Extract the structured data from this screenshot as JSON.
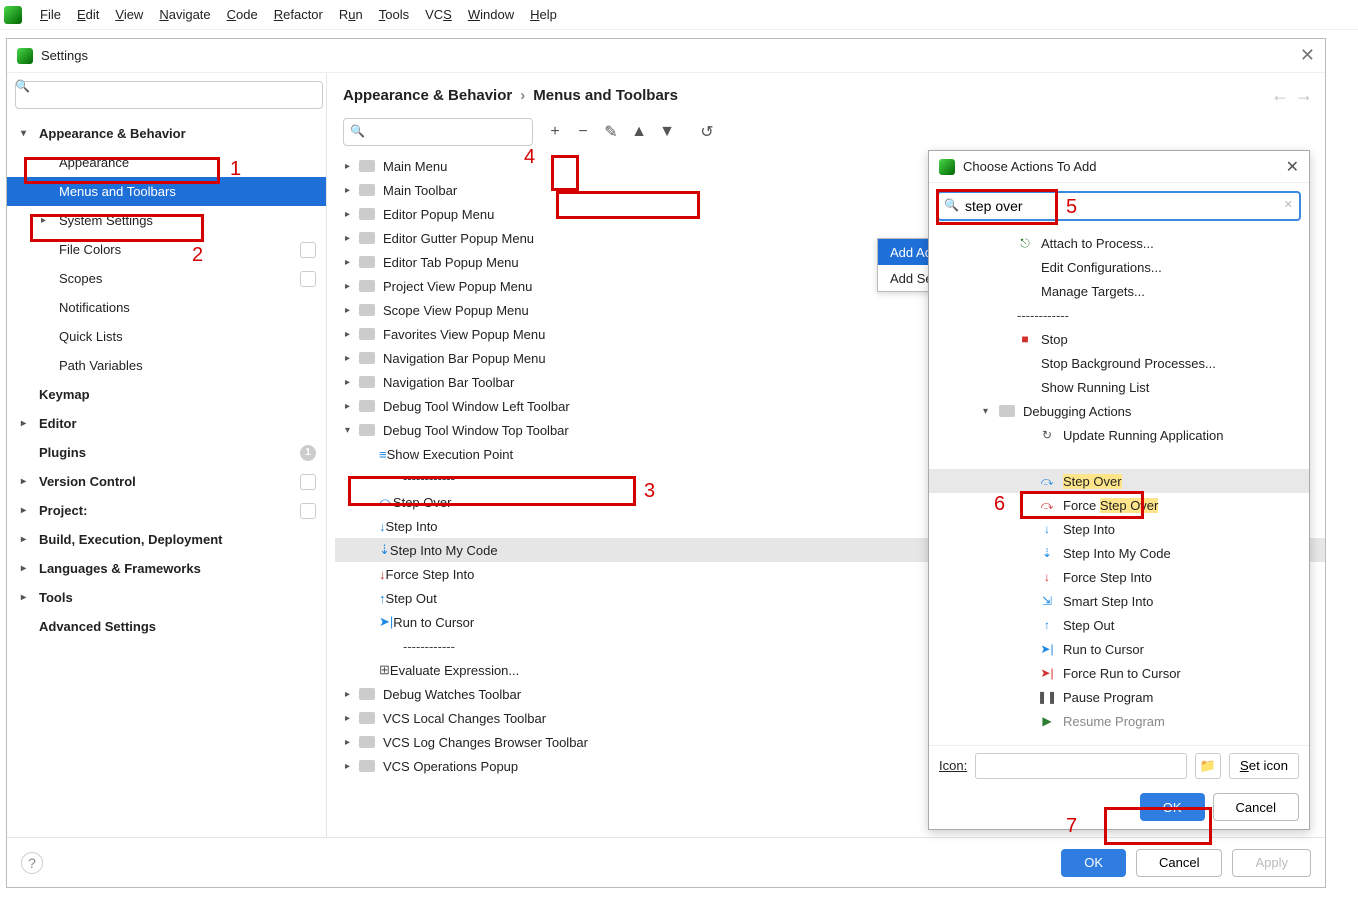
{
  "menubar": [
    "File",
    "Edit",
    "View",
    "Navigate",
    "Code",
    "Refactor",
    "Run",
    "Tools",
    "VCS",
    "Window",
    "Help"
  ],
  "settings": {
    "title": "Settings",
    "breadcrumb": [
      "Appearance & Behavior",
      "Menus and Toolbars"
    ],
    "sidebar": [
      {
        "label": "Appearance & Behavior",
        "level": 1,
        "bold": true,
        "arrow": "▾"
      },
      {
        "label": "Appearance",
        "level": 2
      },
      {
        "label": "Menus and Toolbars",
        "level": 2,
        "selected": true
      },
      {
        "label": "System Settings",
        "level": 2,
        "arrow": "▸"
      },
      {
        "label": "File Colors",
        "level": 2,
        "badge": "▭"
      },
      {
        "label": "Scopes",
        "level": 2,
        "badge": "▭"
      },
      {
        "label": "Notifications",
        "level": 2
      },
      {
        "label": "Quick Lists",
        "level": 2
      },
      {
        "label": "Path Variables",
        "level": 2
      },
      {
        "label": "Keymap",
        "level": 1,
        "bold": true
      },
      {
        "label": "Editor",
        "level": 1,
        "bold": true,
        "arrow": "▸"
      },
      {
        "label": "Plugins",
        "level": 1,
        "bold": true,
        "badge": "1"
      },
      {
        "label": "Version Control",
        "level": 1,
        "bold": true,
        "arrow": "▸",
        "badge": "▭"
      },
      {
        "label": "Project:",
        "level": 1,
        "bold": true,
        "arrow": "▸",
        "badge": "▭"
      },
      {
        "label": "Build, Execution, Deployment",
        "level": 1,
        "bold": true,
        "arrow": "▸"
      },
      {
        "label": "Languages & Frameworks",
        "level": 1,
        "bold": true,
        "arrow": "▸"
      },
      {
        "label": "Tools",
        "level": 1,
        "bold": true,
        "arrow": "▸"
      },
      {
        "label": "Advanced Settings",
        "level": 1,
        "bold": true
      }
    ],
    "toolbar_buttons": [
      "+",
      "−",
      "✎",
      "▲",
      "▼",
      "↺"
    ],
    "popup_menu": [
      "Add Action...",
      "Add Separator"
    ],
    "list": [
      {
        "label": "Main Menu",
        "type": "folder",
        "arrow": "▸"
      },
      {
        "label": "Main Toolbar",
        "type": "folder",
        "arrow": "▸"
      },
      {
        "label": "Editor Popup Menu",
        "type": "folder",
        "arrow": "▸"
      },
      {
        "label": "Editor Gutter Popup Menu",
        "type": "folder",
        "arrow": "▸"
      },
      {
        "label": "Editor Tab Popup Menu",
        "type": "folder",
        "arrow": "▸"
      },
      {
        "label": "Project View Popup Menu",
        "type": "folder",
        "arrow": "▸"
      },
      {
        "label": "Scope View Popup Menu",
        "type": "folder",
        "arrow": "▸"
      },
      {
        "label": "Favorites View Popup Menu",
        "type": "folder",
        "arrow": "▸"
      },
      {
        "label": "Navigation Bar Popup Menu",
        "type": "folder",
        "arrow": "▸"
      },
      {
        "label": "Navigation Bar Toolbar",
        "type": "folder",
        "arrow": "▸"
      },
      {
        "label": "Debug Tool Window Left Toolbar",
        "type": "folder",
        "arrow": "▸"
      },
      {
        "label": "Debug Tool Window Top Toolbar",
        "type": "folder",
        "arrow": "▾",
        "expanded": true
      },
      {
        "label": "Show Execution Point",
        "type": "action",
        "indent": 1,
        "icon": "exec",
        "color": "#1e88e5"
      },
      {
        "label": "------------",
        "type": "sep",
        "indent": 1
      },
      {
        "label": "Step Over",
        "type": "action",
        "indent": 1,
        "icon": "stepover",
        "color": "#1e88e5"
      },
      {
        "label": "Step Into",
        "type": "action",
        "indent": 1,
        "icon": "stepinto",
        "color": "#1e88e5"
      },
      {
        "label": "Step Into My Code",
        "type": "action",
        "indent": 1,
        "icon": "stepmycode",
        "color": "#1e88e5",
        "selected": true
      },
      {
        "label": "Force Step Into",
        "type": "action",
        "indent": 1,
        "icon": "forcestep",
        "color": "#d32f2f"
      },
      {
        "label": "Step Out",
        "type": "action",
        "indent": 1,
        "icon": "stepout",
        "color": "#1e88e5"
      },
      {
        "label": "Run to Cursor",
        "type": "action",
        "indent": 1,
        "icon": "runcursor",
        "color": "#1e88e5"
      },
      {
        "label": "------------",
        "type": "sep",
        "indent": 1
      },
      {
        "label": "Evaluate Expression...",
        "type": "action",
        "indent": 1,
        "icon": "eval",
        "color": "#555"
      },
      {
        "label": "Debug Watches Toolbar",
        "type": "folder",
        "arrow": "▸"
      },
      {
        "label": "VCS Local Changes Toolbar",
        "type": "folder",
        "arrow": "▸"
      },
      {
        "label": "VCS Log Changes Browser Toolbar",
        "type": "folder",
        "arrow": "▸"
      },
      {
        "label": "VCS Operations Popup",
        "type": "folder",
        "arrow": "▸"
      }
    ],
    "buttons": {
      "ok": "OK",
      "cancel": "Cancel",
      "apply": "Apply"
    }
  },
  "dialog": {
    "title": "Choose Actions To Add",
    "search_value": "step over",
    "items": [
      {
        "label": "Attach to Process...",
        "icon": "attach",
        "color": "#2e7d32"
      },
      {
        "label": "Edit Configurations..."
      },
      {
        "label": "Manage Targets..."
      },
      {
        "label": "------------",
        "sep": true
      },
      {
        "label": "Stop",
        "icon": "stop",
        "color": "#d32f2f"
      },
      {
        "label": "Stop Background Processes..."
      },
      {
        "label": "Show Running List"
      },
      {
        "label": "Debugging Actions",
        "hdr": true,
        "arrow": "▾"
      },
      {
        "label": "Update Running Application",
        "sub": true,
        "icon": "update",
        "color": "#555"
      },
      {
        "label": "Step Over",
        "sub": true,
        "icon": "stepover",
        "color": "#1e88e5",
        "selected": true,
        "highlight": "Step Over"
      },
      {
        "label": "Force Step Over",
        "sub": true,
        "icon": "stepover",
        "color": "#d32f2f",
        "highlight": "Step Over"
      },
      {
        "label": "Step Into",
        "sub": true,
        "icon": "stepinto",
        "color": "#1e88e5"
      },
      {
        "label": "Step Into My Code",
        "sub": true,
        "icon": "stepmycode",
        "color": "#1e88e5"
      },
      {
        "label": "Force Step Into",
        "sub": true,
        "icon": "forcestep",
        "color": "#d32f2f"
      },
      {
        "label": "Smart Step Into",
        "sub": true,
        "icon": "smart",
        "color": "#1e88e5"
      },
      {
        "label": "Step Out",
        "sub": true,
        "icon": "stepout",
        "color": "#1e88e5"
      },
      {
        "label": "Run to Cursor",
        "sub": true,
        "icon": "runcursor",
        "color": "#1e88e5"
      },
      {
        "label": "Force Run to Cursor",
        "sub": true,
        "icon": "runcursor",
        "color": "#d32f2f"
      },
      {
        "label": "Pause Program",
        "sub": true,
        "icon": "pause",
        "color": "#555"
      },
      {
        "label": "Resume Program",
        "sub": true,
        "icon": "resume",
        "color": "#2e7d32",
        "cutoff": true
      }
    ],
    "icon_label": "Icon:",
    "set_icon": "Set icon",
    "ok": "OK",
    "cancel": "Cancel"
  },
  "annotations": [
    "1",
    "2",
    "3",
    "4",
    "5",
    "6",
    "7"
  ]
}
